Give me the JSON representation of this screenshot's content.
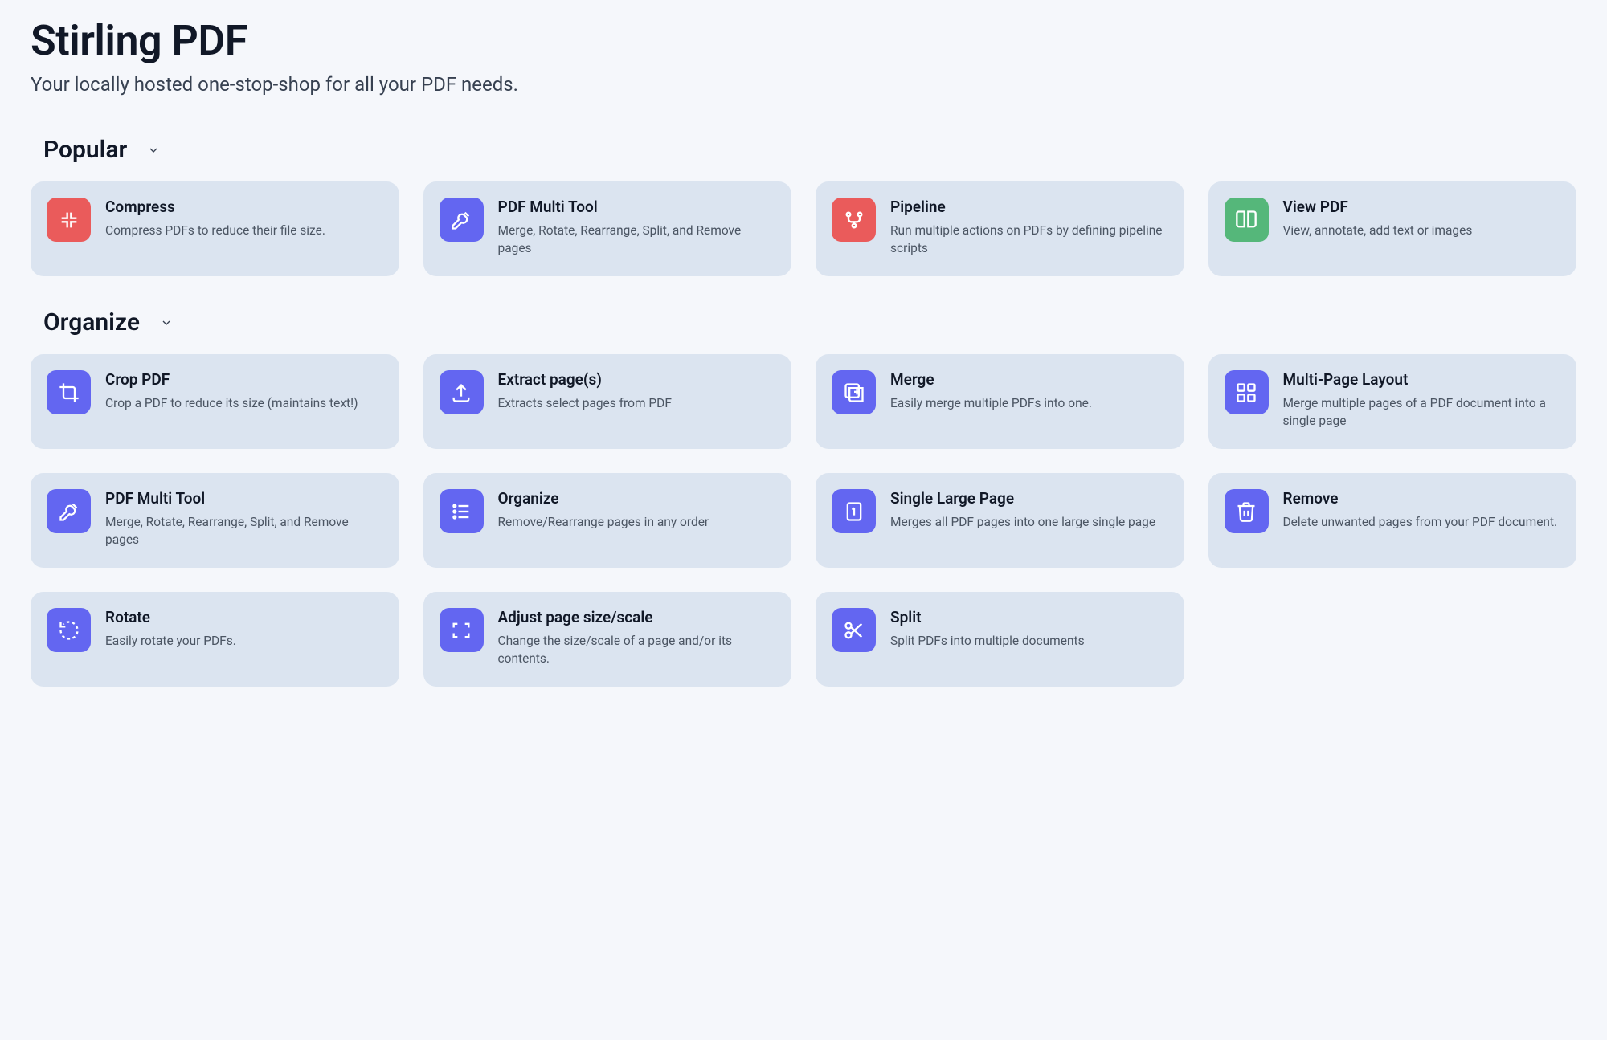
{
  "header": {
    "title": "Stirling PDF",
    "subtitle": "Your locally hosted one-stop-shop for all your PDF needs."
  },
  "sections": {
    "popular": {
      "title": "Popular"
    },
    "organize": {
      "title": "Organize"
    }
  },
  "cards": {
    "compress": {
      "title": "Compress",
      "desc": "Compress PDFs to reduce their file size."
    },
    "multitool": {
      "title": "PDF Multi Tool",
      "desc": "Merge, Rotate, Rearrange, Split, and Remove pages"
    },
    "pipeline": {
      "title": "Pipeline",
      "desc": "Run multiple actions on PDFs by defining pipeline scripts"
    },
    "view": {
      "title": "View PDF",
      "desc": "View, annotate, add text or images"
    },
    "crop": {
      "title": "Crop PDF",
      "desc": "Crop a PDF to reduce its size (maintains text!)"
    },
    "extract": {
      "title": "Extract page(s)",
      "desc": "Extracts select pages from PDF"
    },
    "merge": {
      "title": "Merge",
      "desc": "Easily merge multiple PDFs into one."
    },
    "multipage": {
      "title": "Multi-Page Layout",
      "desc": "Merge multiple pages of a PDF document into a single page"
    },
    "multitool2": {
      "title": "PDF Multi Tool",
      "desc": "Merge, Rotate, Rearrange, Split, and Remove pages"
    },
    "organizecard": {
      "title": "Organize",
      "desc": "Remove/Rearrange pages in any order"
    },
    "singlelarge": {
      "title": "Single Large Page",
      "desc": "Merges all PDF pages into one large single page"
    },
    "remove": {
      "title": "Remove",
      "desc": "Delete unwanted pages from your PDF document."
    },
    "rotate": {
      "title": "Rotate",
      "desc": "Easily rotate your PDFs."
    },
    "adjust": {
      "title": "Adjust page size/scale",
      "desc": "Change the size/scale of a page and/or its contents."
    },
    "split": {
      "title": "Split",
      "desc": "Split PDFs into multiple documents"
    }
  }
}
